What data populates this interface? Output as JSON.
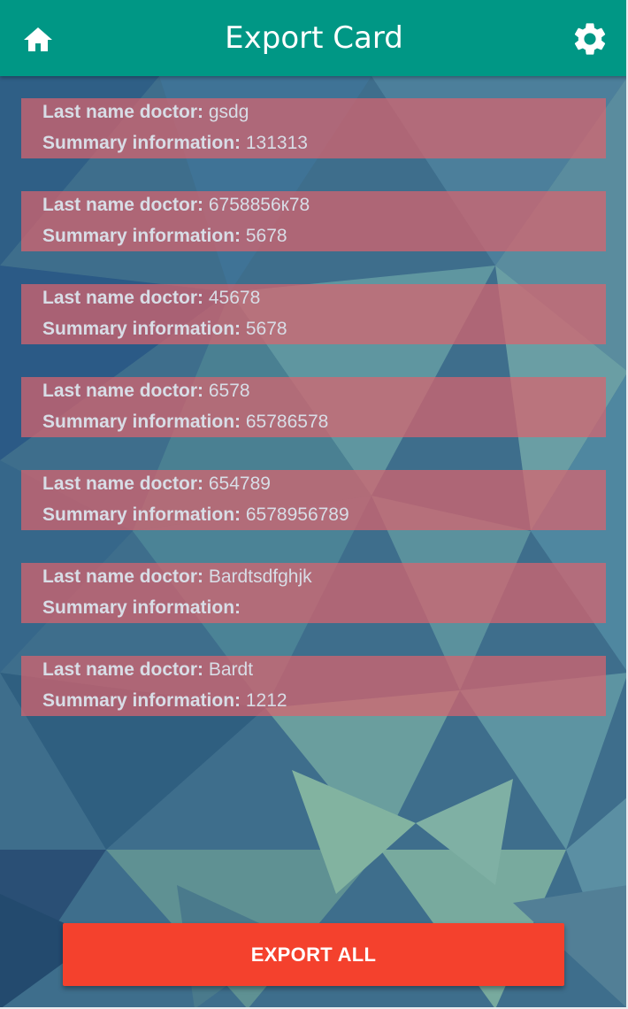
{
  "header": {
    "title": "Export Card",
    "home_icon": "home-icon",
    "settings_icon": "gear-icon",
    "background_color": "#009785"
  },
  "records": [
    {
      "doctor_label": "Last name doctor:",
      "doctor_value": "gsdg",
      "summary_label": "Summary information:",
      "summary_value": "131313"
    },
    {
      "doctor_label": "Last name doctor:",
      "doctor_value": "6758856к78",
      "summary_label": "Summary information:",
      "summary_value": "5678"
    },
    {
      "doctor_label": "Last name doctor:",
      "doctor_value": "45678",
      "summary_label": "Summary information:",
      "summary_value": "5678"
    },
    {
      "doctor_label": "Last name doctor:",
      "doctor_value": "6578",
      "summary_label": "Summary information:",
      "summary_value": "65786578"
    },
    {
      "doctor_label": "Last name doctor:",
      "doctor_value": "654789",
      "summary_label": "Summary information:",
      "summary_value": "6578956789"
    },
    {
      "doctor_label": "Last name doctor:",
      "doctor_value": "Bardtsdfghjk",
      "summary_label": "Summary information:",
      "summary_value": ""
    },
    {
      "doctor_label": "Last name doctor:",
      "doctor_value": "Bardt",
      "summary_label": "Summary information:",
      "summary_value": "1212"
    }
  ],
  "footer": {
    "export_all_label": "EXPORT ALL",
    "button_color": "#f4412d"
  },
  "colors": {
    "record_background": "#da646e",
    "record_text": "#d8dde6"
  }
}
